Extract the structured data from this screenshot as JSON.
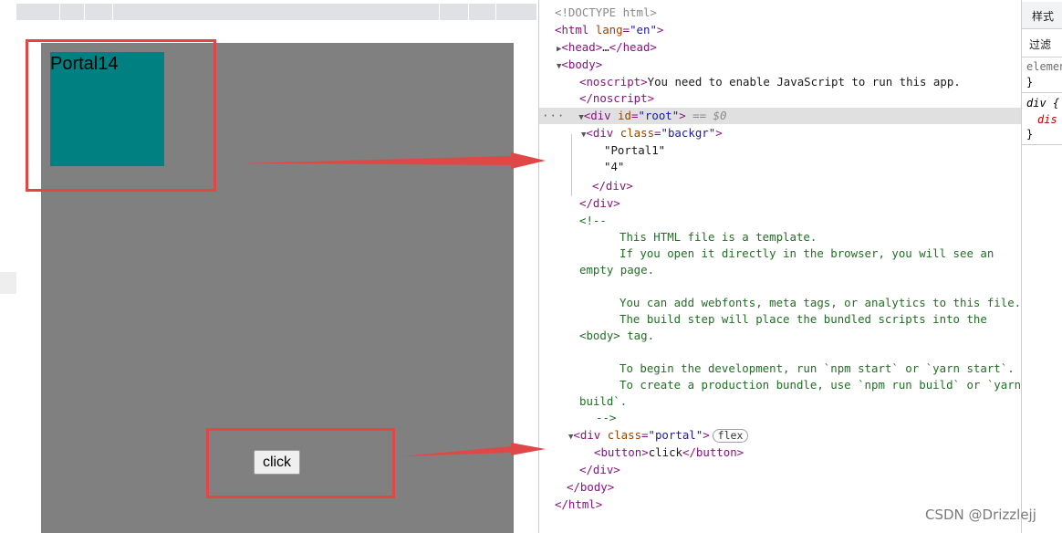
{
  "viewport": {
    "portal_text": "Portal14",
    "button_label": "click"
  },
  "dom_tree": {
    "doctype": "<!DOCTYPE html>",
    "html_open": {
      "tag": "html",
      "attr": "lang",
      "value": "\"en\""
    },
    "head": {
      "open": "<head>",
      "ellipsis": "…",
      "close": "</head>"
    },
    "body_open": "<body>",
    "noscript_open": "<noscript>",
    "noscript_text": "You need to enable JavaScript to run this app.",
    "noscript_close": "</noscript>",
    "root_div": {
      "attr": "id",
      "value": "\"root\"",
      "suffix": "== $0"
    },
    "background_div": {
      "attr": "class",
      "value": "\"backgr\"",
      "text_1": "\"Portal1\"",
      "text_2": "\"4\""
    },
    "div_close": "</div>",
    "comment_open": "<!--",
    "comment_lines": [
      "This HTML file is a template.",
      "If you open it directly in the browser, you will see an",
      "empty page.",
      "You can add webfonts, meta tags, or analytics to this file.",
      "The build step will place the bundled scripts into the",
      "<body> tag.",
      "To begin the development, run `npm start` or `yarn start`.",
      "To create a production bundle, use `npm run build` or `yarn",
      "build`."
    ],
    "comment_close": "-->",
    "portal_div": {
      "attr": "class",
      "value": "\"portal\"",
      "badge": "flex"
    },
    "button_open": "<button>",
    "button_text": "click",
    "button_close": "</button>",
    "body_close": "</body>",
    "html_close": "</html>"
  },
  "styles_pane": {
    "tab_label": "样式",
    "filter_label": "过滤",
    "element_rule": "element",
    "rule_close": "}",
    "div_rule": "div {",
    "div_prop": "dis"
  },
  "watermark": "CSDN @Drizzlejj",
  "colors": {
    "page_background": "#808080",
    "portal_box": "#008080",
    "highlight": "#e04848"
  }
}
